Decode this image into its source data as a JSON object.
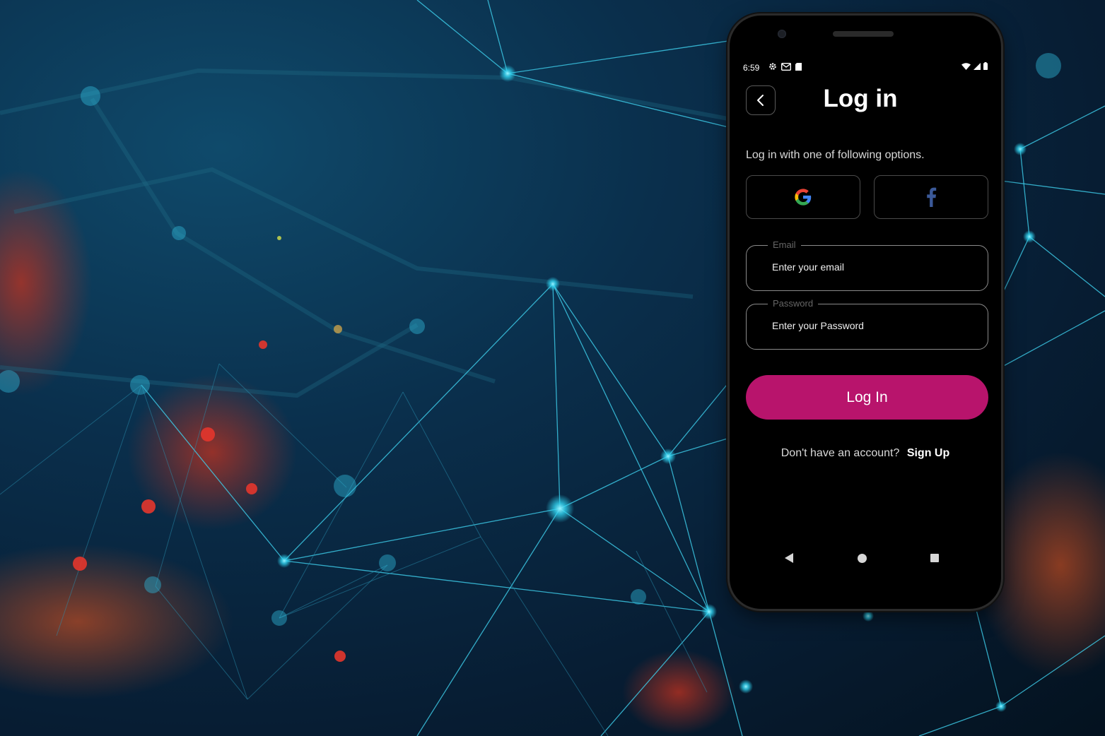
{
  "status_bar": {
    "time": "6:59"
  },
  "header": {
    "title": "Log in"
  },
  "subtitle": "Log in with one of following options.",
  "social": {
    "google_icon": "google-icon",
    "facebook_icon": "facebook-icon"
  },
  "email": {
    "label": "Email",
    "placeholder": "Enter your email"
  },
  "password": {
    "label": "Password",
    "placeholder": "Enter your Password"
  },
  "login_button": "Log In",
  "signup": {
    "prompt": "Don't have an account?",
    "link": "Sign Up"
  },
  "colors": {
    "accent": "#b8146c",
    "background": "#000000",
    "facebook": "#3b5998"
  }
}
